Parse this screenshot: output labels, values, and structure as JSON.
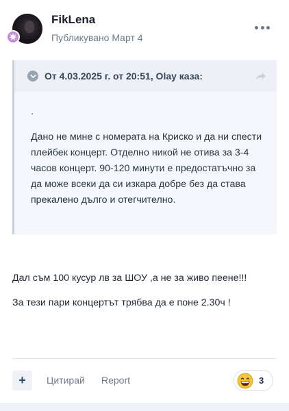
{
  "post": {
    "author": "FikLena",
    "date": "Публикувано Март 4",
    "more_icon": "ellipsis-icon"
  },
  "quote": {
    "citation": "От 4.03.2025 г. от 20:51, Olay каза:",
    "toggle_icon": "chevron-down-icon",
    "share_icon": "share-arrow-icon",
    "dot": ".",
    "text": "Дано не мине с номерата на Криско и да ни спести плейбек концерт. Отделно никой не отива за 3-4 часов концерт. 90-120 минути е предостатъчно за да може всеки да си изкара добре без да става прекалено дълго и отегчително."
  },
  "body": {
    "line1": "Дал съм 100 кусур лв за ШОУ ,а не за живо пеене!!!",
    "line2": "За тези пари концертът трябва да е поне 2.30ч !"
  },
  "footer": {
    "plus_label": "+",
    "quote_label": "Цитирай",
    "report_label": "Report",
    "reaction_icon": "grinning-face-icon",
    "reaction_count": "3"
  },
  "colors": {
    "badge": "#c58ad9",
    "quote_bg": "#f4f7fb",
    "link": "#6e7a88"
  }
}
